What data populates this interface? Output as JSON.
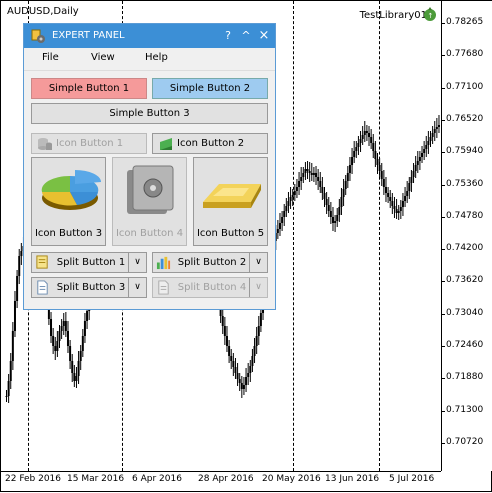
{
  "chart": {
    "title": "AUDUSD,Daily",
    "library_label": "TestLibrary01",
    "y_ticks": [
      "0.78265",
      "0.77680",
      "0.77100",
      "0.76520",
      "0.75940",
      "0.75360",
      "0.74780",
      "0.74200",
      "0.73620",
      "0.73040",
      "0.72460",
      "0.71880",
      "0.71300",
      "0.70720"
    ],
    "x_ticks": [
      "22 Feb 2016",
      "15 Mar 2016",
      "6 Apr 2016",
      "28 Apr 2016",
      "20 May 2016",
      "13 Jun 2016",
      "5 Jul 2016"
    ]
  },
  "panel": {
    "title": "EXPERT PANEL",
    "help_label": "?",
    "collapse_label": "^",
    "close_label": "×",
    "menu": [
      "File",
      "View",
      "Help"
    ],
    "simple_button_1": "Simple Button 1",
    "simple_button_2": "Simple Button 2",
    "simple_button_3": "Simple Button 3",
    "icon_button_1": "Icon Button 1",
    "icon_button_2": "Icon Button 2",
    "icon_button_3": "Icon Button 3",
    "icon_button_4": "Icon Button 4",
    "icon_button_5": "Icon Button 5",
    "split_button_1": "Split Button 1",
    "split_button_2": "Split Button 2",
    "split_button_3": "Split Button 3",
    "split_button_4": "Split Button 4",
    "dropdown_glyph": "∨"
  },
  "colors": {
    "titlebar": "#3c8fd6",
    "simple_button_1_bg": "#f59a9a",
    "simple_button_2_bg": "#9ecbf0"
  }
}
